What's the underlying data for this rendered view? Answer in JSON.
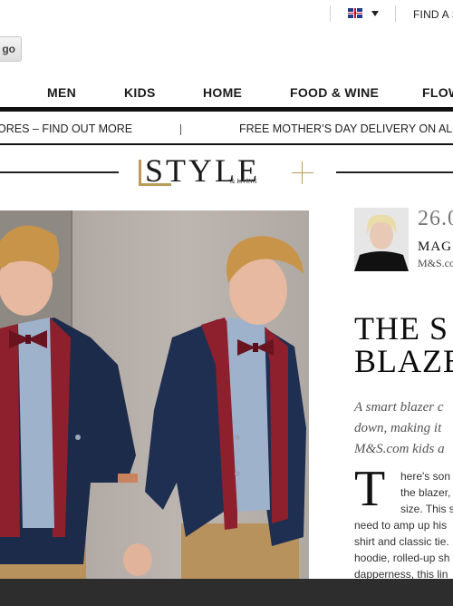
{
  "topbar": {
    "country_flag": "uk-flag-icon",
    "find_label": "FIND A S"
  },
  "search": {
    "go_label": "go"
  },
  "nav": {
    "items": [
      "MEN",
      "KIDS",
      "HOME",
      "FOOD & WINE",
      "FLOW"
    ]
  },
  "promo": {
    "left": "ORES – FIND OUT MORE",
    "right": "FREE MOTHER’S DAY DELIVERY ON ALL F"
  },
  "logo": {
    "main": "STYLE",
    "sub": "& LIVING",
    "accent_color": "#b89c57"
  },
  "article": {
    "date": "26.0",
    "author_name": "MAG",
    "author_role": "M&S.co",
    "headline_line1": "THE S",
    "headline_line2": "BLAZE",
    "standfirst": [
      "A smart blazer c",
      "down, making it",
      "M&S.com kids a"
    ],
    "dropcap": "T",
    "body_indented": [
      "here's son",
      "the blazer,",
      "size. This s"
    ],
    "body_full": [
      "need to amp up his",
      "shirt and classic tie.",
      "hoodie, rolled-up sh",
      "dapperness, this lin"
    ]
  },
  "colors": {
    "footer": "#2d2d2d",
    "nav_rule": "#111111"
  }
}
